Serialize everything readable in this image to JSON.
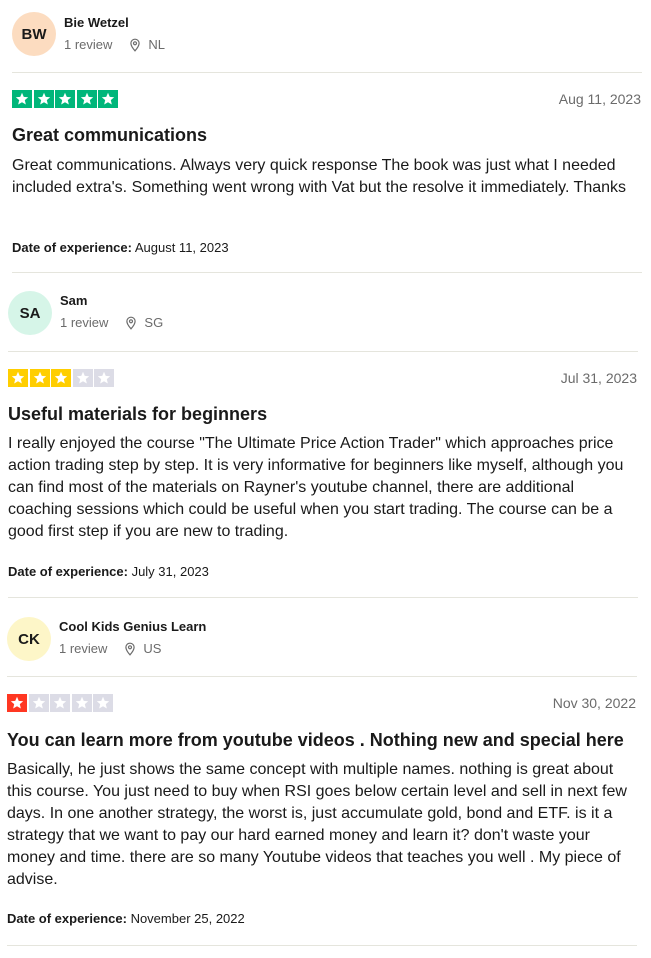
{
  "reviews": [
    {
      "initials": "BW",
      "avatar_color": "#fcdcc0",
      "name": "Bie Wetzel",
      "review_count": "1 review",
      "country": "NL",
      "rating": 5,
      "star_color": "#00b67a",
      "date": "Aug 11, 2023",
      "title": "Great communications",
      "body": "Great communications. Always very quick response The book was just what I needed included extra's. Something went wrong with Vat but the resolve it immediately. Thanks",
      "experience_label": "Date of experience:",
      "experience_date": "August 11, 2023"
    },
    {
      "initials": "SA",
      "avatar_color": "#d6f5e8",
      "name": "Sam",
      "review_count": "1 review",
      "country": "SG",
      "rating": 3,
      "star_color": "#ffce00",
      "date": "Jul 31, 2023",
      "title": "Useful materials for beginners",
      "body": "I really enjoyed the course \"The Ultimate Price Action Trader\" which approaches price action trading step by step. It is very informative for beginners like myself, although you can find most of the materials on Rayner's youtube channel, there are additional coaching sessions which could be useful when you start trading. The course can be a good first step if you are new to trading.",
      "experience_label": "Date of experience:",
      "experience_date": "July 31, 2023"
    },
    {
      "initials": "CK",
      "avatar_color": "#fdf6c8",
      "name": "Cool Kids Genius Learn",
      "review_count": "1 review",
      "country": "US",
      "rating": 1,
      "star_color": "#ff3722",
      "date": "Nov 30, 2022",
      "title": "You can learn more from youtube videos . Nothing new and special here",
      "body": "Basically, he just shows the same concept with multiple names. nothing is great about this course. You just need to buy when RSI goes below certain level and sell in next few days. In one another strategy, the worst is, just accumulate gold, bond and ETF. is it a strategy that we want to pay our hard earned money and learn it? don't waste your money and time. there are so many Youtube videos that teaches you well . My piece of advise.",
      "experience_label": "Date of experience:",
      "experience_date": "November 25, 2022"
    }
  ],
  "empty_star_color": "#dcdce6"
}
